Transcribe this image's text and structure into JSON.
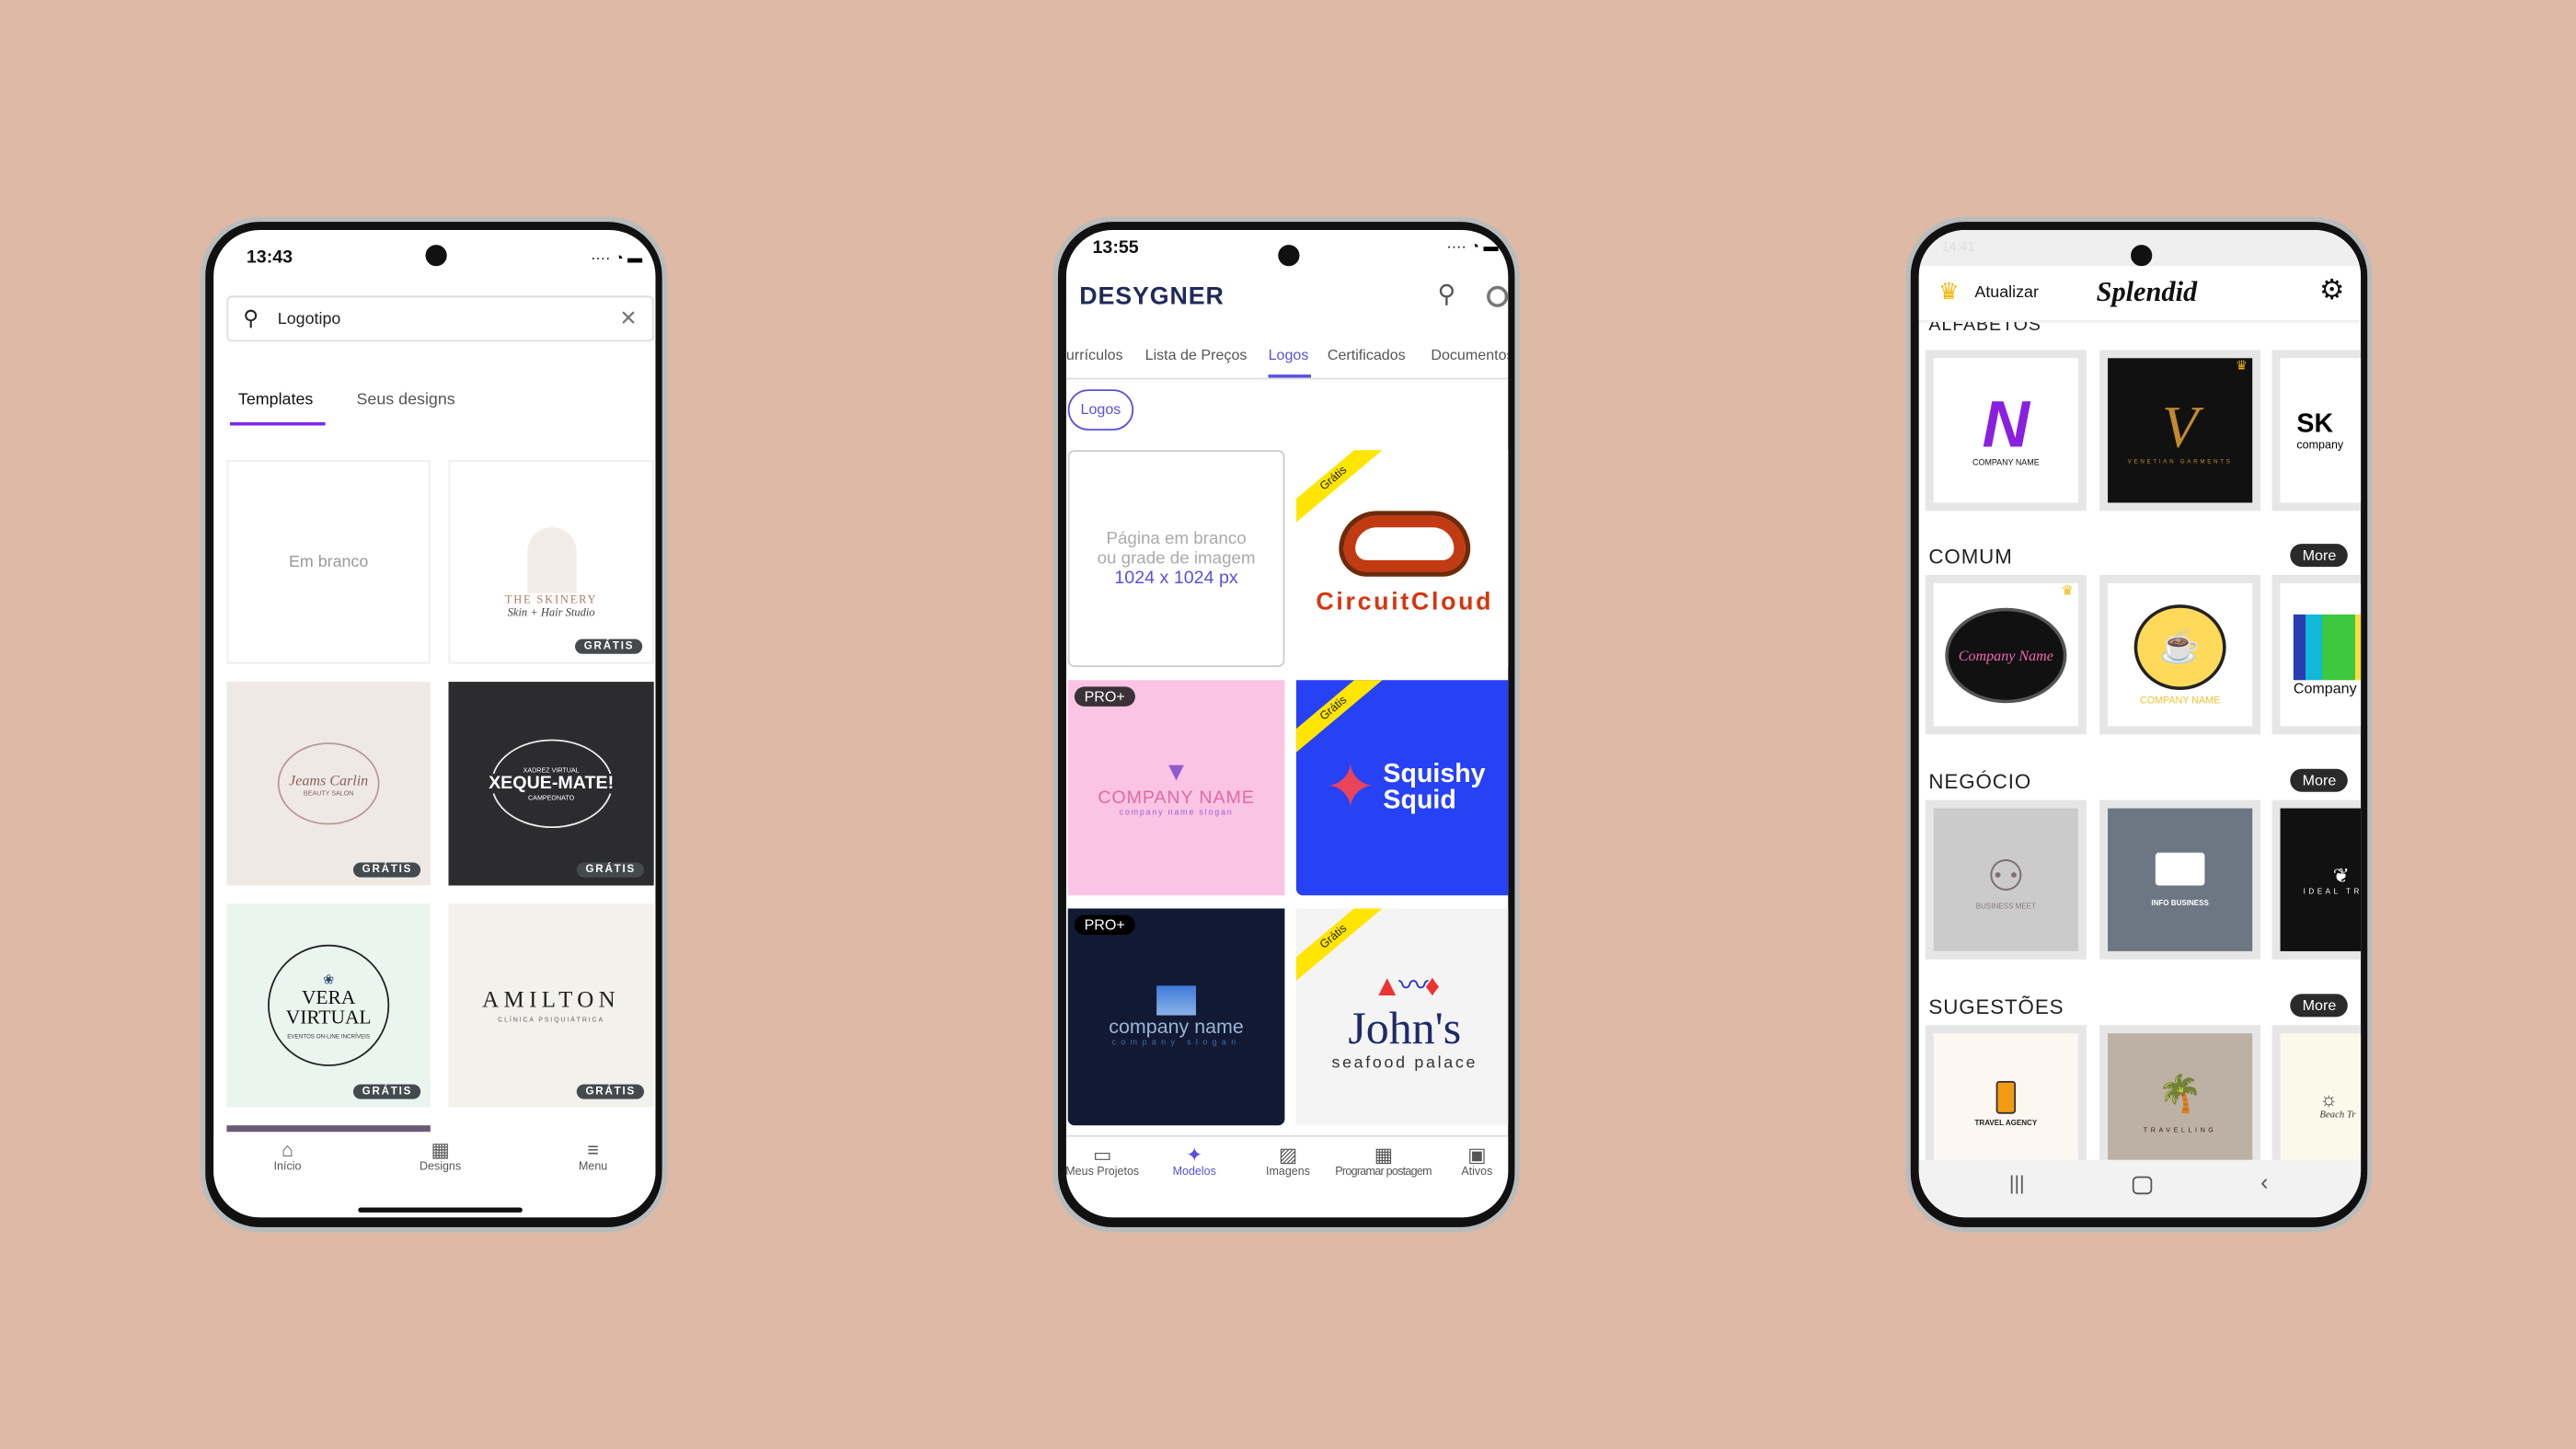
{
  "phone1": {
    "status_time": "13:43",
    "search_value": "Logotipo",
    "tabs": [
      "Templates",
      "Seus designs"
    ],
    "blank_label": "Em branco",
    "badge": "GRÁTIS",
    "cards": [
      {
        "title": "THE SKINERY",
        "sub": "Skin + Hair Studio"
      },
      {
        "title": "Jeams Carlin",
        "sub": "BEAUTY SALON"
      },
      {
        "title": "XEQUE-MATE!",
        "top": "XADREZ VIRTUAL",
        "sub": "CAMPEONATO"
      },
      {
        "title": "VERA VIRTUAL",
        "sub": "EVENTOS ON-LINE INCRÍVEIS"
      },
      {
        "title": "AMILTON",
        "sub": "CLÍNICA PSIQUIÁTRICA"
      }
    ],
    "nav": [
      "Início",
      "Designs",
      "Menu"
    ]
  },
  "phone2": {
    "status_time": "13:55",
    "app_title": "DESYGNER",
    "tabs": [
      "urrículos",
      "Lista de Preços",
      "Logos",
      "Certificados",
      "Documentos"
    ],
    "active_tab": "Logos",
    "chip": "Logos",
    "blank_line1": "Página em branco",
    "blank_line2": "ou grade de imagem",
    "blank_size": "1024 x 1024 px",
    "ribbon": "Grátis",
    "pro_badge": "PRO+",
    "cards": [
      {
        "title": "CircuitCloud"
      },
      {
        "title": "COMPANY NAME",
        "sub": "company name slogan"
      },
      {
        "title": "Squishy Squid"
      },
      {
        "title": "company name",
        "sub": "company slogan"
      },
      {
        "title": "John's",
        "sub": "seafood palace"
      }
    ],
    "nav": [
      "Meus Projetos",
      "Modelos",
      "Imagens",
      "Programar postagem",
      "Ativos"
    ],
    "accent": "#5b4fe0"
  },
  "phone3": {
    "status_time": "14:41",
    "upgrade_label": "Atualizar",
    "app_title": "Splendid",
    "more_label": "More",
    "sections": [
      {
        "title": "ALFABETOS",
        "cards": [
          "COMPANY NAME",
          "VENETIAN GARMENTS",
          "company"
        ]
      },
      {
        "title": "COMUM",
        "cards": [
          "Company Name",
          "COMPANY NAME",
          "Company"
        ]
      },
      {
        "title": "NEGÓCIO",
        "cards": [
          "BUSINESS MEET",
          "INFO BUSINESS",
          "IDEAL TRA"
        ]
      },
      {
        "title": "SUGESTÕES",
        "cards": [
          "TRAVEL AGENCY",
          "TRAVELLING",
          "Beach Tr"
        ]
      }
    ]
  }
}
